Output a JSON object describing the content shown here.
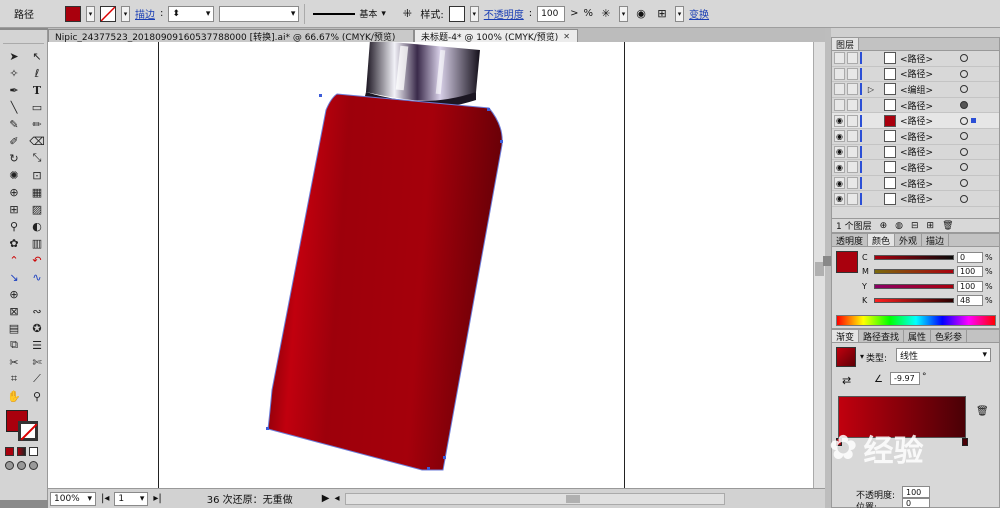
{
  "control_bar": {
    "selection_label": "路径",
    "stroke_label": "描边",
    "style_label": "基本",
    "style_prefix": "样式:",
    "opacity_label": "不透明度",
    "opacity_value": "100",
    "opacity_unit": "%",
    "transform_label": "变换",
    "fill_color": "#a9000d"
  },
  "tabs": [
    {
      "label": "Nipic_24377523_20180909160537788000 [转换].ai* @ 66.67% (CMYK/预览)"
    },
    {
      "label": "未标题-4* @ 100% (CMYK/预览)"
    }
  ],
  "status": {
    "zoom": "100%",
    "artboard": "1",
    "undo_text": "36 次还原：无重做"
  },
  "layers": {
    "title": "图层",
    "rows": [
      {
        "name": "<路径>"
      },
      {
        "name": "<路径>"
      },
      {
        "name": "<编组>"
      },
      {
        "name": "<路径>"
      },
      {
        "name": "<路径>"
      },
      {
        "name": "<路径>"
      },
      {
        "name": "<路径>"
      },
      {
        "name": "<路径>"
      },
      {
        "name": "<路径>"
      },
      {
        "name": "<路径>"
      }
    ],
    "footer": "1 个图层"
  },
  "color_panel": {
    "tabs": [
      "透明度",
      "颜色",
      "外观",
      "描边"
    ],
    "channels": [
      {
        "label": "C",
        "value": "0",
        "unit": "%"
      },
      {
        "label": "M",
        "value": "100",
        "unit": "%"
      },
      {
        "label": "Y",
        "value": "100",
        "unit": "%"
      },
      {
        "label": "K",
        "value": "48",
        "unit": "%"
      }
    ],
    "swatch_color": "#a9000d"
  },
  "gradient_panel": {
    "tabs": [
      "渐变",
      "路径查找",
      "属性",
      "色彩参"
    ],
    "type_label": "类型:",
    "type_value": "线性",
    "angle_value": "-9.97",
    "angle_unit": "°",
    "opacity_label": "不透明度:",
    "opacity_value": "100",
    "position_label": "位置:",
    "position_value": "0"
  },
  "watermark": "经验"
}
